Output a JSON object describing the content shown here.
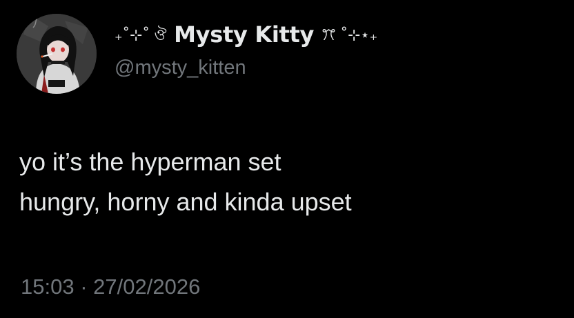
{
  "tweet": {
    "author": {
      "display_name_prefix": "₊˚⊹˚ ঔ",
      "display_name": "Mysty Kitty",
      "display_name_suffix": "ꔫ ˚⊹⋆₊",
      "handle": "@mysty_kitten",
      "avatar_icon": "anime-girl-avatar"
    },
    "text_lines": [
      "yo it’s the hyperman set",
      "hungry, horny and kinda upset"
    ],
    "time": "15:03",
    "separator": "·",
    "date": "27/02/2026"
  },
  "colors": {
    "background": "#000000",
    "primary_text": "#e7e9ea",
    "secondary_text": "#71767b"
  }
}
